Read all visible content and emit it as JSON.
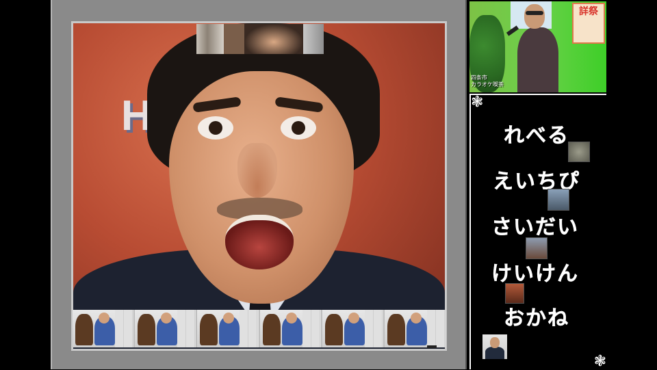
{
  "main_video": {
    "background_text": "H",
    "colors": {
      "frame": "#8a8a8a",
      "background": "#b84c33"
    }
  },
  "filmstrip": {
    "frame_count": 6
  },
  "webcam": {
    "caption_line1": "四条市",
    "caption_line2": "カラオケ喫茶",
    "poster_text": "詳祭"
  },
  "word_list": {
    "items": [
      {
        "text": "れべる"
      },
      {
        "text": "えいちぴ"
      },
      {
        "text": "さいだい"
      },
      {
        "text": "けいけん"
      },
      {
        "text": "おかね"
      }
    ],
    "decoration_icon": "flourish-icon"
  }
}
